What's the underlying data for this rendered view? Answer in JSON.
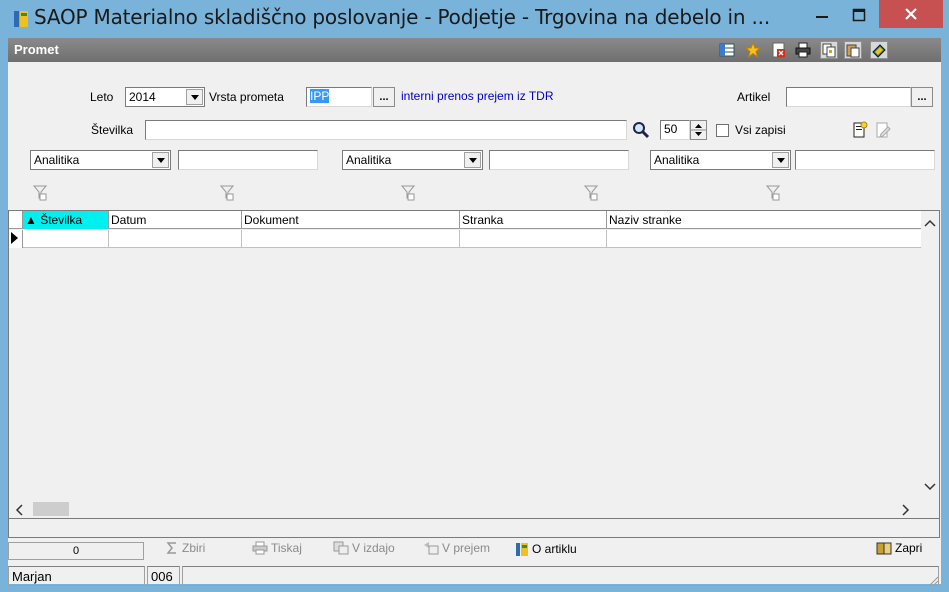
{
  "window": {
    "title": "SAOP Materialno skladiščno poslovanje - Podjetje - Trgovina na debelo in ...",
    "titlebar_color": "#7ab3d9",
    "close_color": "#c75050"
  },
  "panel": {
    "title": "Promet"
  },
  "filters": {
    "leto_label": "Leto",
    "leto_value": "2014",
    "vrsta_label": "Vrsta prometa",
    "vrsta_value": "IPP",
    "vrsta_ellipsis": "...",
    "vrsta_description": "interni prenos prejem iz TDR",
    "artikel_label": "Artikel",
    "artikel_value": "",
    "artikel_ellipsis": "...",
    "stevilka_label": "Številka",
    "stevilka_value": "",
    "limit_value": "50",
    "vsi_zapisi_label": "Vsi zapisi",
    "analitika": [
      {
        "value": "Analitika",
        "text": ""
      },
      {
        "value": "Analitika",
        "text": ""
      },
      {
        "value": "Analitika",
        "text": ""
      }
    ]
  },
  "grid": {
    "columns": [
      {
        "label": "▲ Številka",
        "sorted": true
      },
      {
        "label": "Datum",
        "sorted": false
      },
      {
        "label": "Dokument",
        "sorted": false
      },
      {
        "label": "Stranka",
        "sorted": false
      },
      {
        "label": "Naziv stranke",
        "sorted": false
      }
    ],
    "sort_color": "#00f0f0"
  },
  "actions": {
    "count": "0",
    "zbiri": "Zbiri",
    "tiskaj": "Tiskaj",
    "v_izdajo": "V izdajo",
    "v_prejem": "V prejem",
    "o_artiklu": "O artiklu",
    "zapri": "Zapri"
  },
  "status": {
    "user": "Marjan",
    "code": "006",
    "extra": ""
  }
}
